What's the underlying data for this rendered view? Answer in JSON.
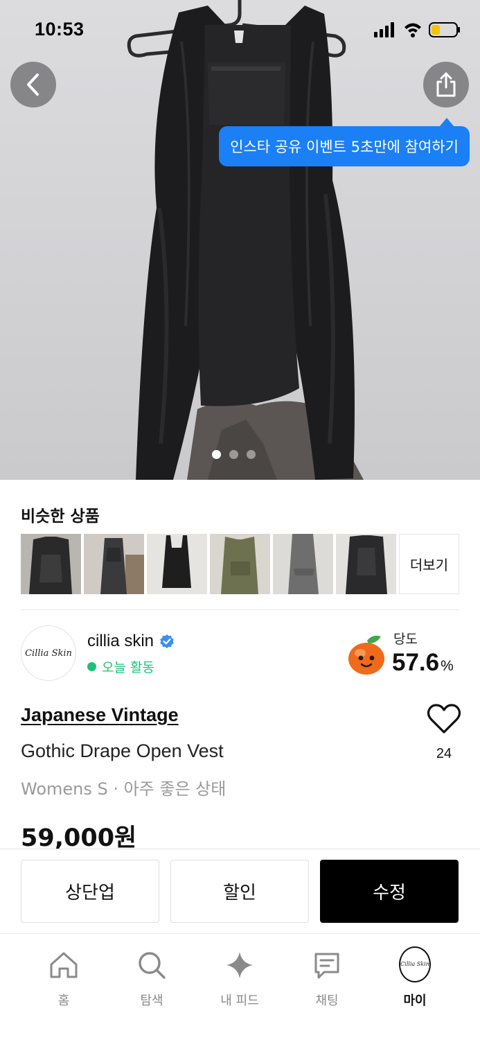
{
  "status_bar": {
    "time": "10:53"
  },
  "hero": {
    "tooltip": "인스타 공유 이벤트 5초만에 참여하기",
    "image_count": 3,
    "active_image_index": 1
  },
  "similar": {
    "title": "비슷한 상품",
    "more_label": "더보기",
    "thumbnail_count": 6
  },
  "seller": {
    "name": "cillia skin",
    "avatar_text": "Cillia Skin",
    "activity": "오늘 활동",
    "sweetness_label": "당도",
    "sweetness_value": "57.6",
    "sweetness_unit": "%"
  },
  "product": {
    "brand": "Japanese Vintage",
    "name": "Gothic Drape Open Vest",
    "meta": "Womens S · 아주 좋은 상태",
    "price": "59,000원",
    "like_count": "24"
  },
  "actions": {
    "bump_label": "상단업",
    "discount_label": "할인",
    "edit_label": "수정"
  },
  "tabbar": {
    "home_label": "홈",
    "search_label": "탐색",
    "feed_label": "내 피드",
    "chat_label": "채팅",
    "my_label": "마이",
    "my_avatar_text": "Cillia Skin"
  },
  "colors": {
    "tooltip_blue": "#1b7ff5",
    "activity_green": "#1ec27a",
    "verified_blue": "#3a8ff0",
    "primary_button": "#000000"
  },
  "icons": [
    "chevron-left-icon",
    "share-icon",
    "verified-icon",
    "peach-icon",
    "heart-icon",
    "home-icon",
    "search-icon",
    "sparkle-icon",
    "chat-icon",
    "signal-icon",
    "wifi-icon",
    "battery-icon"
  ]
}
